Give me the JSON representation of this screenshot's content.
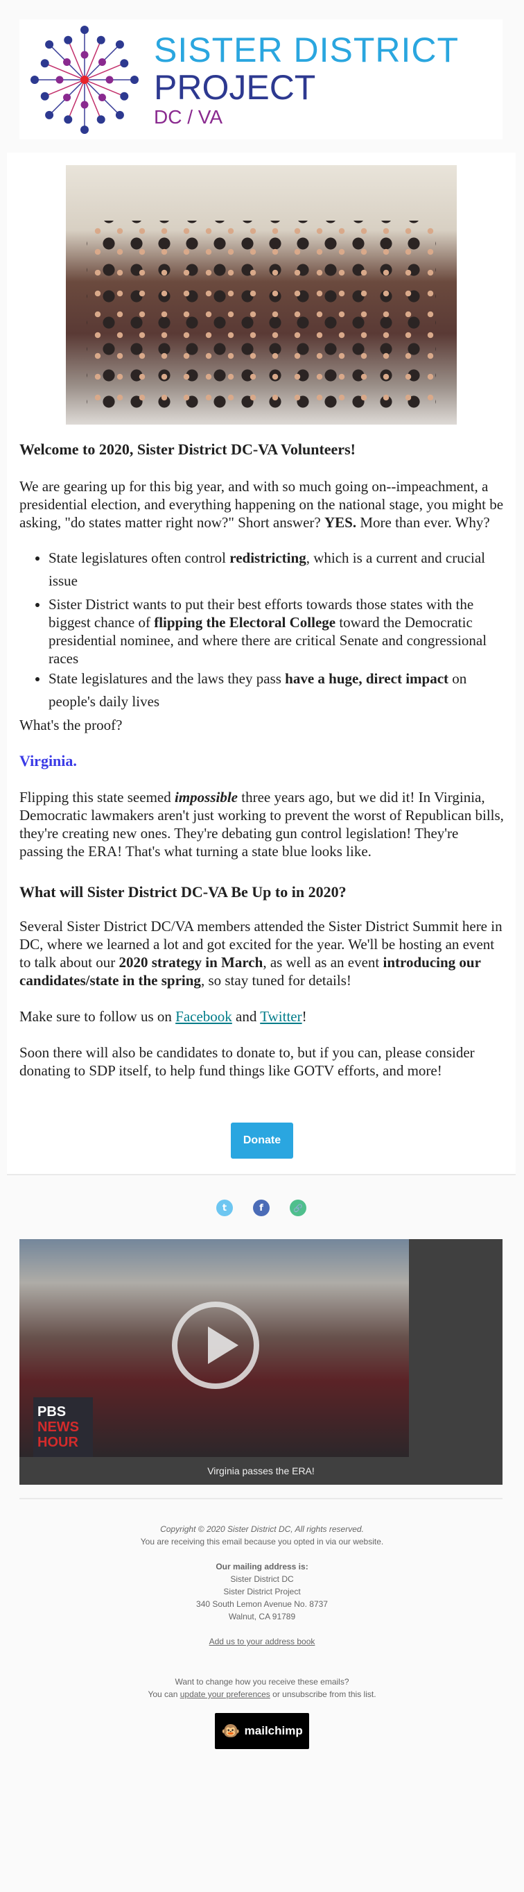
{
  "header": {
    "logo_line1": "SISTER DISTRICT",
    "logo_line2": "PROJECT",
    "logo_line3": "DC / VA"
  },
  "content": {
    "welcome_heading": "Welcome to 2020, Sister District DC-VA Volunteers!",
    "intro": {
      "text": "We are gearing up for this big year, and with so much going on--impeachment, a presidential election, and everything happening on the national stage, you might be asking, \"do states matter right now?\" Short answer? ",
      "bold": "YES.",
      "after": " More than ever. Why?"
    },
    "bullets": [
      {
        "pre": "State legislatures often control ",
        "bold": "redistricting",
        "post": ", which is a current and crucial issue"
      },
      {
        "pre": "Sister District wants to put their best efforts towards those states with the biggest chance of ",
        "bold": "flipping the Electoral College",
        "post": " toward the Democratic presidential nominee, and where there are critical Senate and congressional races"
      },
      {
        "pre": "State legislatures and the laws they pass ",
        "bold": "have a huge, direct impact",
        "post": " on people's daily lives"
      }
    ],
    "proof": "What's the proof?",
    "virginia": "Virginia.",
    "flipping": {
      "pre": "Flipping this state seemed ",
      "em": "impossible",
      "post": " three years ago, but we did it! In Virginia, Democratic lawmakers aren't just working to prevent the worst of Republican bills, they're creating new ones. They're debating gun control legislation! They're passing the ERA! That's what turning a state blue looks like."
    },
    "heading2": "What will Sister District DC-VA Be Up to in 2020?",
    "several": {
      "pre": "Several Sister District DC/VA members attended the Sister District Summit here in DC, where we learned a lot and got excited for the year. We'll be hosting an event to talk about our ",
      "bold1": "2020 strategy in March",
      "mid": ", as well as an event ",
      "bold2": "introducing our candidates/state in the spring",
      "post": ", so stay tuned for details!"
    },
    "follow": {
      "pre": "Make sure to follow us on ",
      "facebook": "Facebook",
      "and": " and ",
      "twitter": "Twitter",
      "post": "!"
    },
    "donate_text": "Soon there will also be candidates to donate to, but if you can, please consider donating to SDP itself, to help fund things like GOTV efforts, and more!",
    "donate_button": "Donate"
  },
  "social": {
    "twitter_icon": "t",
    "facebook_icon": "f",
    "link_icon": "🔗",
    "colors": {
      "twitter": "#6dc6f1",
      "facebook": "#4b6cb7",
      "link": "#4fbf8d"
    }
  },
  "video": {
    "pbs_line1": "PBS",
    "pbs_line2": "NEWS",
    "pbs_line3": "HOUR",
    "caption": "Virginia passes the ERA!"
  },
  "footer": {
    "copyright": "Copyright © 2020 Sister District DC, All rights reserved.",
    "reason": "You are receiving this email because you opted in via our website.",
    "mailing_label": "Our mailing address is:",
    "address": [
      "Sister District DC",
      "Sister District Project",
      "340 South Lemon Avenue No. 8737",
      "Walnut, CA 91789"
    ],
    "address_book": "Add us to your address book",
    "change": "Want to change how you receive these emails?",
    "you_can": "You can ",
    "update_prefs": "update your preferences",
    "unsub": " or unsubscribe from this list.",
    "mailchimp": "mailchimp"
  }
}
